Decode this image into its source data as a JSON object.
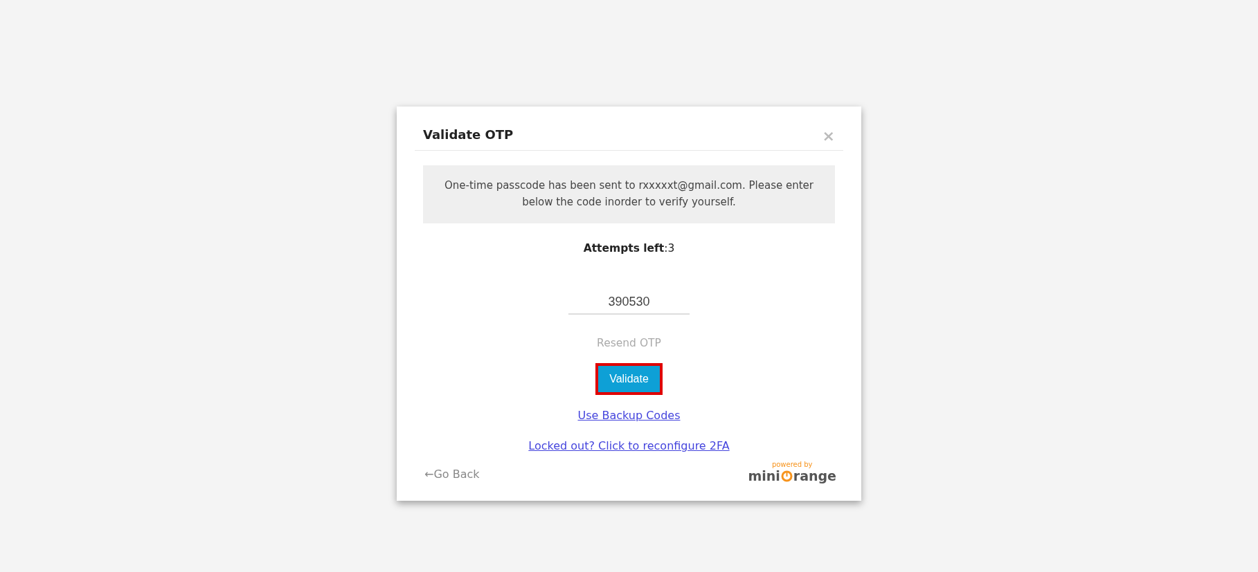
{
  "dialog": {
    "title": "Validate OTP",
    "close": "×",
    "message": "One-time passcode has been sent to rxxxxxt@gmail.com. Please enter below the code inorder to verify yourself.",
    "attempts": "**Attempts left**:3",
    "otp_field": {
      "value": "390530"
    },
    "resend": {
      "label": "Resend OTP",
      "disabled": true
    },
    "validate_button": {
      "label": "Validate",
      "highlighted": true
    },
    "links": [
      "Use Backup Codes",
      "Locked out? Click to reconfigure 2FA"
    ],
    "go_back": "←Go Back",
    "logo": {
      "tagline": "powered by",
      "left": "mini",
      "right": "range"
    }
  }
}
